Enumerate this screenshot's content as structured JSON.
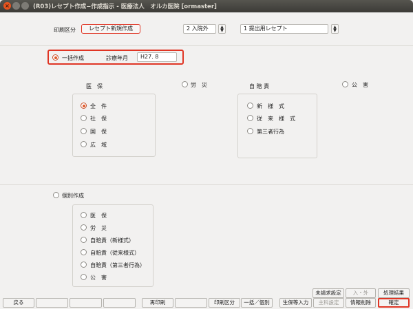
{
  "window": {
    "title": "(R03)レセプト作成−作成指示 - 医療法人　オルカ医院 [ormaster]"
  },
  "header": {
    "print_kubun_label": "印刷区分",
    "print_kubun_button": "レセプト新規作成",
    "nyuingai_value": "2 入院外",
    "teishutsu_value": "1 提出用レセプト"
  },
  "ikkatsu": {
    "label": "一括作成",
    "shinryo_label": "診療年月",
    "shinryo_value": "H27. 8",
    "iho_label": "医　保",
    "iho_options": [
      "全　件",
      "社　保",
      "国　保",
      "広　域"
    ],
    "rousai_label": "労　災",
    "jibaiseki_label": "自 賠 責",
    "jibaiseki_options": [
      "新　様　式",
      "従　来　様　式",
      "第三者行為"
    ],
    "kougai_label": "公　害"
  },
  "kobetsu": {
    "label": "個別作成",
    "options": [
      "医　保",
      "労　災",
      "自賠責（新様式）",
      "自賠責（従来様式）",
      "自賠責（第三者行為）",
      "公　害"
    ]
  },
  "top_buttons": {
    "miseikyu": "未請求設定",
    "nyugai": "入・外",
    "shori_kekka": "処理結果"
  },
  "footer": {
    "back": "戻る",
    "reprint": "再印刷",
    "print_kubun": "印刷区分",
    "ikkatsu_kobetsu": "一括／個別",
    "seiho_input": "生保等入力",
    "shuka_settei": "主科設定",
    "joho_sakujo": "情報削除",
    "kakutei": "確定"
  }
}
